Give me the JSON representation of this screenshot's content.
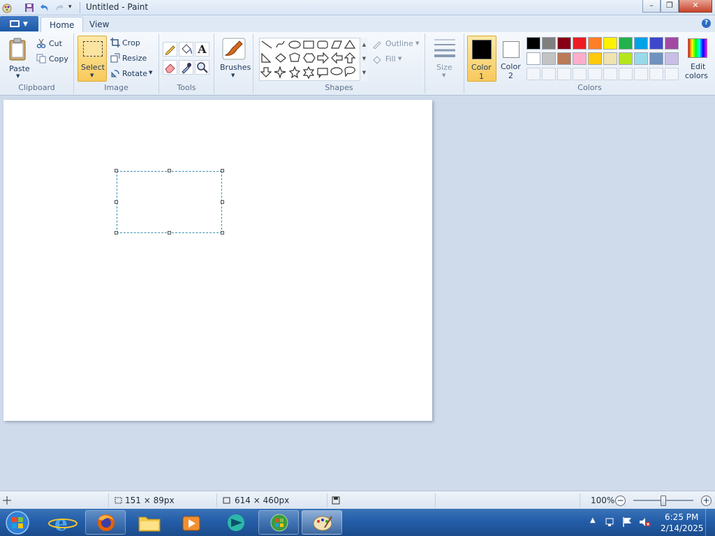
{
  "window": {
    "title": "Untitled - Paint",
    "minimize": "–",
    "maximize": "❐",
    "close": "✕"
  },
  "tabs": {
    "home": "Home",
    "view": "View",
    "help": "?"
  },
  "clipboard": {
    "paste": "Paste",
    "cut": "Cut",
    "copy": "Copy",
    "label": "Clipboard"
  },
  "image": {
    "select": "Select",
    "crop": "Crop",
    "resize": "Resize",
    "rotate": "Rotate",
    "label": "Image"
  },
  "tools": {
    "label": "Tools",
    "text_glyph": "A"
  },
  "brushes": {
    "label": "Brushes"
  },
  "shapes": {
    "outline": "Outline",
    "fill": "Fill",
    "label": "Shapes"
  },
  "size": {
    "label": "Size"
  },
  "colors": {
    "color1_label": "Color",
    "color1_num": "1",
    "color2_label": "Color",
    "color2_num": "2",
    "edit1": "Edit",
    "edit2": "colors",
    "label": "Colors",
    "color1_value": "#000000",
    "color2_value": "#ffffff",
    "row1": [
      "#000000",
      "#7f7f7f",
      "#880015",
      "#ed1c24",
      "#ff7f27",
      "#fff200",
      "#22b14c",
      "#00a2e8",
      "#3f48cc",
      "#a349a4"
    ],
    "row2": [
      "#ffffff",
      "#c3c3c3",
      "#b97a57",
      "#ffaec9",
      "#ffc90e",
      "#efe4b0",
      "#b5e61d",
      "#99d9ea",
      "#7092be",
      "#c8bfe7"
    ]
  },
  "status": {
    "selection_size": "151 × 89px",
    "canvas_size": "614 × 460px",
    "zoom": "100%",
    "zoom_out": "−",
    "zoom_in": "+",
    "zoom_level_fraction": 0.5
  },
  "taskbar": {
    "time": "6:25 PM",
    "date": "2/14/2025"
  }
}
